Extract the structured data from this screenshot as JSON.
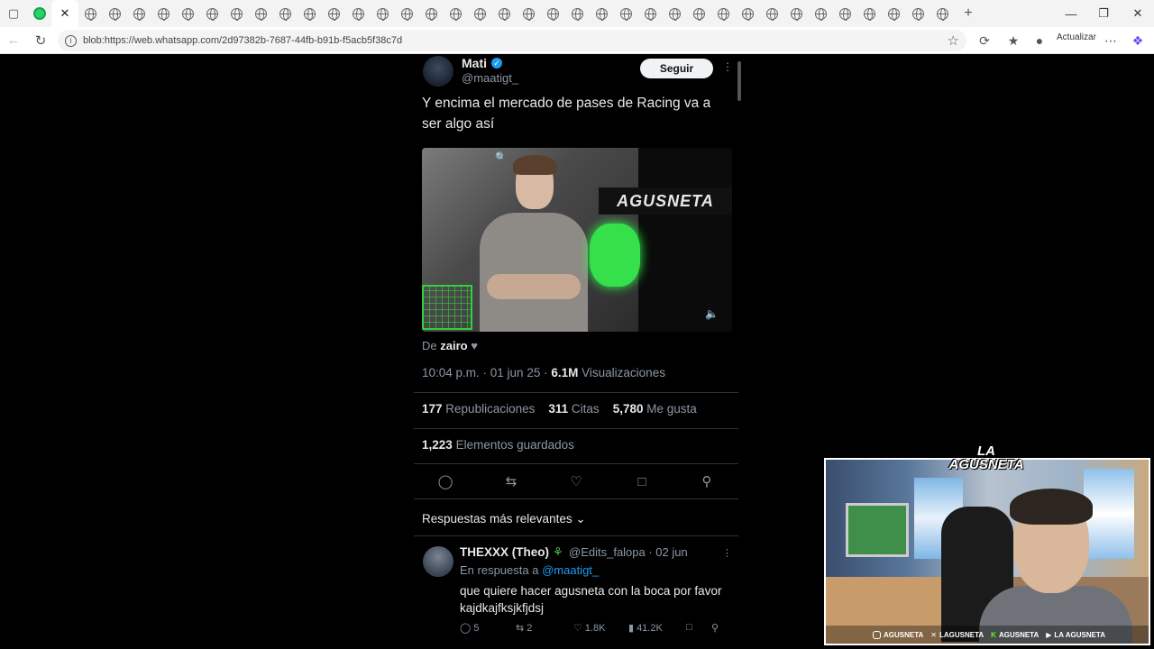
{
  "browser": {
    "url": "blob:https://web.whatsapp.com/2d97382b-7687-44fb-b91b-f5acb5f38c7d",
    "update_label": "Actualizar",
    "tab_count_globe": 36
  },
  "tweet": {
    "author_name": "Mati",
    "author_handle": "@maatigt_",
    "follow_label": "Seguir",
    "text": "Y encima el mercado de pases de Racing va a ser algo así",
    "media_logo": "AGUSNETA",
    "source_prefix": "De",
    "source_name": "zairo",
    "time": "10:04 p.m. · 01 jun 25 ·",
    "views_count": "6.1M",
    "views_label": "Visualizaciones",
    "reposts_count": "177",
    "reposts_label": "Republicaciones",
    "quotes_count": "311",
    "quotes_label": "Citas",
    "likes_count": "5,780",
    "likes_label": "Me gusta",
    "bookmarks_count": "1,223",
    "bookmarks_label": "Elementos guardados",
    "sort_label": "Respuestas más relevantes"
  },
  "reply": {
    "name": "THEXXX (Theo)",
    "handle_date": "@Edits_falopa · 02 jun",
    "reply_to_prefix": "En respuesta a",
    "reply_to_handle": "@maatigt_",
    "text": "que quiere hacer agusneta con la boca por favor kajdkajfksjkfjdsj",
    "replies": "5",
    "reposts": "2",
    "likes": "1.8K",
    "views": "41.2K"
  },
  "webcam": {
    "logo": "LA AGUSNETA",
    "socials": [
      "AGUSNETA",
      "LAGUSNETA",
      "AGUSNETA",
      "LA AGUSNETA"
    ]
  },
  "colors": {
    "accent_blue": "#1d9bf0",
    "muted_text": "#8b98a5",
    "primary_text": "#e7e9ea"
  }
}
